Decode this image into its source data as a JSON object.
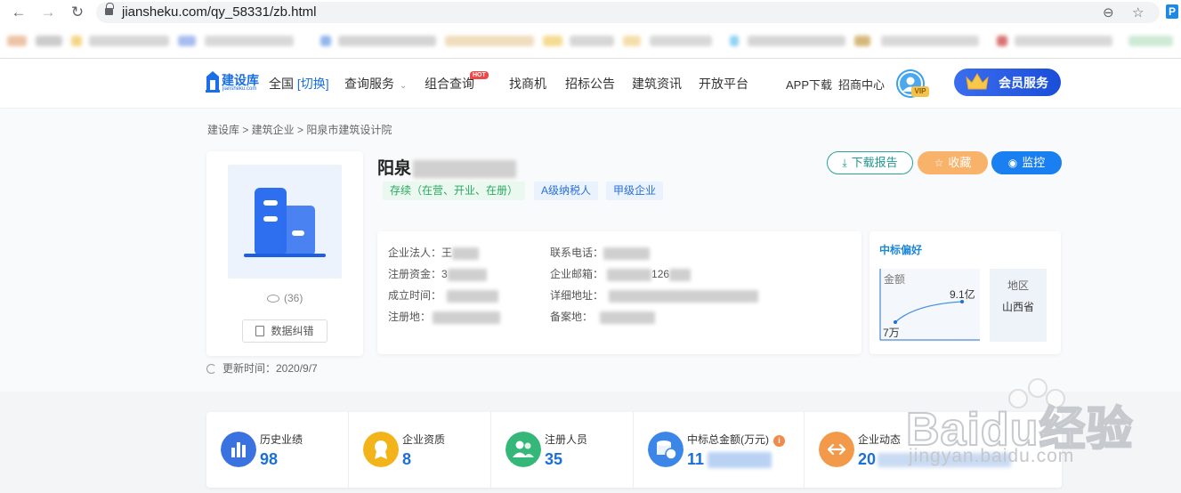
{
  "browser": {
    "url": "jiansheku.com/qy_58331/zb.html",
    "back_icon": "arrow-left-icon",
    "forward_icon": "arrow-right-icon",
    "reload_icon": "reload-icon"
  },
  "site": {
    "logo_name": "建设库",
    "logo_domain": "jiansheku.com",
    "nav": {
      "region": "全国",
      "region_switch": "[切换]",
      "query_service": "查询服务",
      "combo_query": "组合查询",
      "hot_badge": "HOT",
      "find_business": "找商机",
      "tender_notice": "招标公告",
      "construction_news": "建筑资讯",
      "open_platform": "开放平台",
      "app_download": "APP下载",
      "merchant_center": "招商中心",
      "vip_tag": "VIP",
      "member_service": "会员服务"
    }
  },
  "breadcrumb": "建设库 > 建筑企业 > 阳泉市建筑设计院",
  "company": {
    "name_visible": "阳泉",
    "tags": [
      "存续（在营、开业、在册）",
      "A级纳税人",
      "甲级企业"
    ],
    "views": "(36)",
    "correct_button": "数据纠错",
    "update_time": "更新时间：2020/9/7",
    "actions": {
      "download": "下载报告",
      "favorite": "收藏",
      "monitor": "监控"
    },
    "info": {
      "legal_rep_label": "企业法人：",
      "legal_rep_value": "王",
      "capital_label": "注册资金：",
      "capital_value": "3",
      "founded_label": "成立时间：",
      "reg_place_label": "注册地：",
      "phone_label": "联系电话：",
      "email_label": "企业邮箱：",
      "email_value": "126",
      "address_label": "详细地址：",
      "record_label": "备案地："
    },
    "preference": {
      "title": "中标偏好",
      "chart_label": "金额",
      "max_label": "9.1亿",
      "min_label": "7万",
      "region_label": "地区",
      "region_value": "山西省"
    }
  },
  "stats": [
    {
      "label": "历史业绩",
      "value": "98",
      "color": "#3a72e0"
    },
    {
      "label": "企业资质",
      "value": "8",
      "color": "#f2b418"
    },
    {
      "label": "注册人员",
      "value": "35",
      "color": "#35b77a"
    },
    {
      "label": "中标总金额(万元)",
      "value": "11",
      "color": "#3c86e8"
    },
    {
      "label": "企业动态",
      "value": "20",
      "color": "#f39a4a"
    }
  ],
  "watermark": {
    "text": "jingyan.baidu.com",
    "big": "Baidu经验"
  },
  "colors": {
    "brand": "#1a6ee8",
    "green": "#2aa861",
    "orange": "#f8b26a"
  }
}
